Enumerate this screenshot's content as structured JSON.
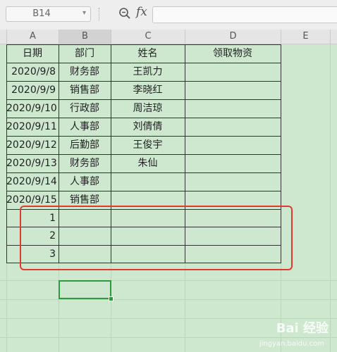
{
  "formula_bar": {
    "name_box": "B14",
    "fx_label": "fx",
    "formula": ""
  },
  "columns": [
    "A",
    "B",
    "C",
    "D",
    "E"
  ],
  "selected_column": "B",
  "headers": {
    "date": "日期",
    "dept": "部门",
    "name": "姓名",
    "supplies": "领取物资"
  },
  "rows": [
    {
      "date": "2020/9/8",
      "dept": "财务部",
      "name": "王凯力",
      "supplies": ""
    },
    {
      "date": "2020/9/9",
      "dept": "销售部",
      "name": "李晓红",
      "supplies": ""
    },
    {
      "date": "2020/9/10",
      "dept": "行政部",
      "name": "周洁琼",
      "supplies": ""
    },
    {
      "date": "2020/9/11",
      "dept": "人事部",
      "name": "刘倩倩",
      "supplies": ""
    },
    {
      "date": "2020/9/12",
      "dept": "后勤部",
      "name": "王俊宇",
      "supplies": ""
    },
    {
      "date": "2020/9/13",
      "dept": "财务部",
      "name": "朱仙",
      "supplies": ""
    },
    {
      "date": "2020/9/14",
      "dept": "人事部",
      "name": "",
      "supplies": ""
    },
    {
      "date": "2020/9/15",
      "dept": "销售部",
      "name": "",
      "supplies": ""
    }
  ],
  "extra_rows": [
    "1",
    "2",
    "3"
  ],
  "colors": {
    "sheet_bg": "#cde8cf",
    "highlight": "#e03a2f",
    "active_cell": "#2e9a3c"
  },
  "watermark": {
    "text": "Bai 经验",
    "sub": "jingyan.baidu.com"
  }
}
